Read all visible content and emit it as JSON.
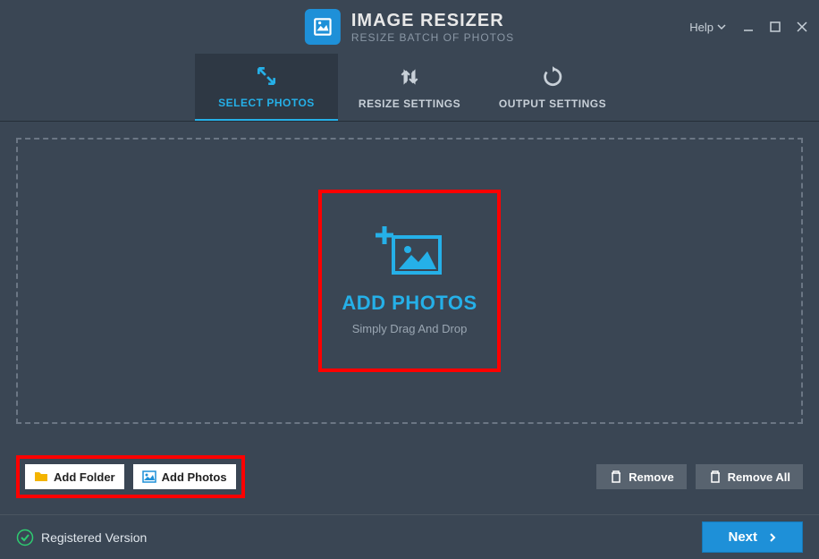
{
  "app": {
    "title": "IMAGE RESIZER",
    "subtitle": "RESIZE BATCH OF PHOTOS"
  },
  "menu": {
    "help_label": "Help"
  },
  "tabs": {
    "select_photos": "SELECT PHOTOS",
    "resize_settings": "RESIZE SETTINGS",
    "output_settings": "OUTPUT SETTINGS"
  },
  "dropzone": {
    "title": "ADD PHOTOS",
    "subtitle": "Simply Drag And Drop"
  },
  "toolbar": {
    "add_folder": "Add Folder",
    "add_photos": "Add Photos",
    "remove": "Remove",
    "remove_all": "Remove All"
  },
  "footer": {
    "status": "Registered Version",
    "next_label": "Next"
  }
}
